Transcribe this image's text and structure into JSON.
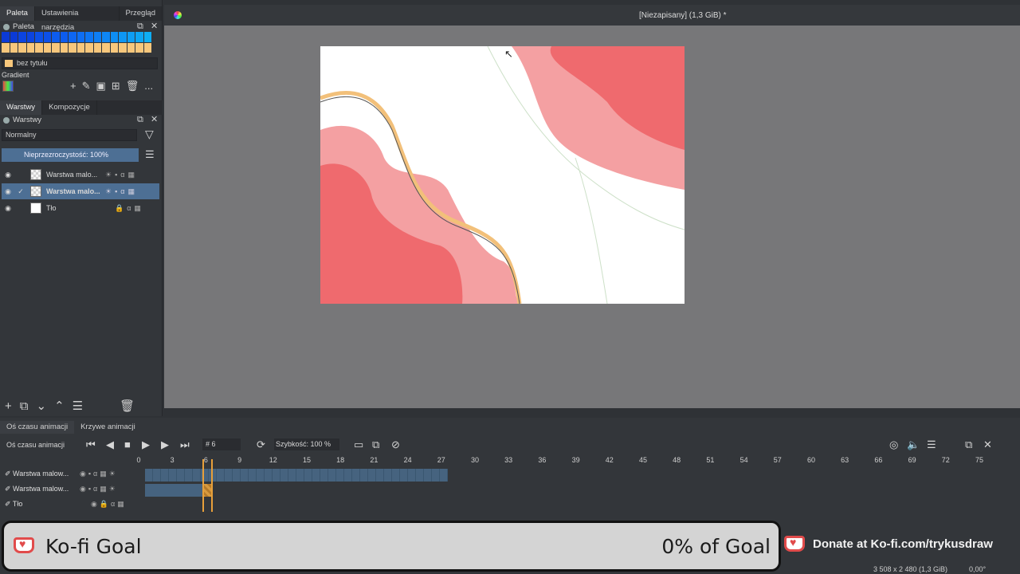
{
  "left_tabs": [
    "Paleta",
    "Ustawienia narzędzia",
    "Przegląd"
  ],
  "palette": {
    "title": "Paleta",
    "name": "bez tytułu",
    "colors_row1": [
      "#0b3ad6",
      "#0b3ad6",
      "#0c44e0",
      "#0c44e0",
      "#0d50e8",
      "#0d50e8",
      "#0d5cee",
      "#0d5cee",
      "#0e66f2",
      "#0e6ef4",
      "#0e76f4",
      "#0e7ef4",
      "#0e86f4",
      "#0e8ef4",
      "#0e96f4",
      "#0e9ef4",
      "#0ea6f4",
      "#0eaef4"
    ],
    "colors_row2": [
      "#f7c77c",
      "#f7c77c",
      "#f7c77c",
      "#f7c77c",
      "#f7c77c",
      "#f7c77c",
      "#f7c77c",
      "#f7c77c",
      "#f7c77c",
      "#f7c77c",
      "#f7c77c",
      "#f7c77c",
      "#f7c77c",
      "#f7c77c",
      "#f7c77c",
      "#f7c77c",
      "#f7c77c",
      "#f7c77c"
    ],
    "gradient_label": "Gradient",
    "more": "..."
  },
  "layers_tabs": [
    "Warstwy",
    "Kompozycje"
  ],
  "layers": {
    "title": "Warstwy",
    "blend_mode": "Normalny",
    "opacity_label": "Nieprzezroczystość:  100%",
    "items": [
      {
        "name": "Warstwa malo...",
        "selected": false
      },
      {
        "name": "Warstwa malo...",
        "selected": true
      },
      {
        "name": "Tło",
        "selected": false
      }
    ]
  },
  "document": {
    "title": "[Niezapisany]  (1,3 GiB) *"
  },
  "timeline": {
    "tabs": [
      "Oś czasu animacji",
      "Krzywe animacji"
    ],
    "title": "Oś czasu animacji",
    "frame_label": "#  6",
    "speed_label": "Szybkość: 100 %",
    "ruler": [
      "0",
      "3",
      "6",
      "9",
      "12",
      "15",
      "18",
      "21",
      "24",
      "27",
      "30",
      "33",
      "36",
      "39",
      "42",
      "45",
      "48",
      "51",
      "54",
      "57",
      "60",
      "63",
      "66",
      "69",
      "72",
      "75"
    ],
    "rows": [
      "Warstwa malow...",
      "Warstwa malow...",
      "Tło"
    ]
  },
  "kofi": {
    "title": "Ko-fi Goal",
    "goal": "0% of Goal",
    "donate": "Donate at Ko-fi.com/trykusdraw"
  },
  "status": {
    "size": "3 508 x 2 480 (1,3 GiB)",
    "rotation": "0,00°"
  },
  "colors": {
    "accent": "#4d6f94",
    "brand_red": "#e14b4b"
  }
}
